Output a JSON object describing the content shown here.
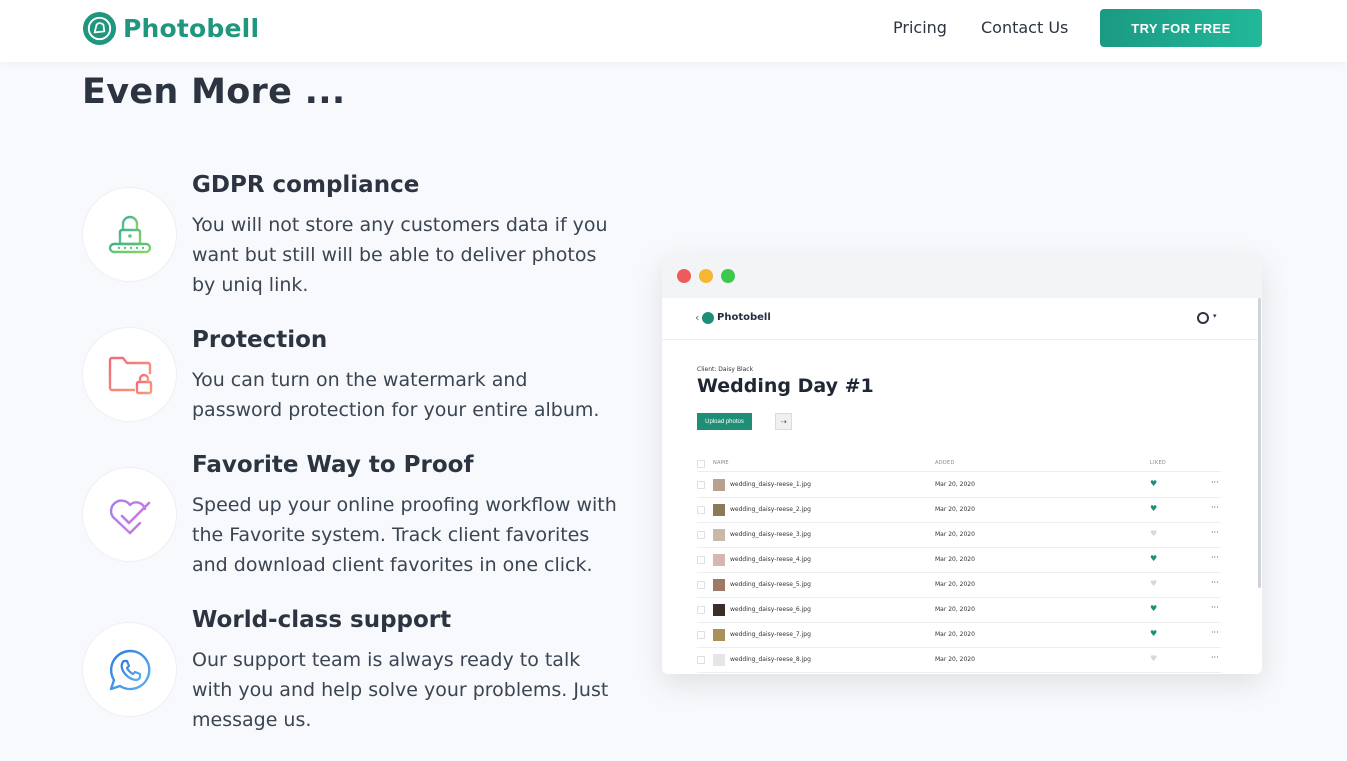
{
  "nav": {
    "brand": "Photobell",
    "pricing": "Pricing",
    "contact": "Contact Us",
    "cta": "TRY FOR FREE"
  },
  "section": {
    "title": "Even More ..."
  },
  "features": [
    {
      "title": "GDPR compliance",
      "text": "You will not store any customers data if you want but still will be able to deliver photos by uniq link.",
      "icon": "lock-icon"
    },
    {
      "title": "Protection",
      "text": "You can turn on the watermark and password protection for your entire album.",
      "icon": "folder-lock-icon"
    },
    {
      "title": "Favorite Way to Proof",
      "text": "Speed up your online proofing workflow with the Favorite system. Track client favorites and download client favorites in one click.",
      "icon": "heart-check-icon"
    },
    {
      "title": "World-class support",
      "text": "Our support team is always ready to talk with you and help solve your problems. Just message us.",
      "icon": "chat-phone-icon"
    }
  ],
  "mock": {
    "brand": "Photobell",
    "client": "Client: Daisy Black",
    "album_title": "Wedding Day #1",
    "upload": "Upload photos",
    "columns": {
      "name": "NAME",
      "added": "ADDED",
      "liked": "LIKED"
    },
    "rows": [
      {
        "name": "wedding_daisy-reese_1.jpg",
        "date": "Mar 20, 2020",
        "liked": true
      },
      {
        "name": "wedding_daisy-reese_2.jpg",
        "date": "Mar 20, 2020",
        "liked": true
      },
      {
        "name": "wedding_daisy-reese_3.jpg",
        "date": "Mar 20, 2020",
        "liked": false
      },
      {
        "name": "wedding_daisy-reese_4.jpg",
        "date": "Mar 20, 2020",
        "liked": true
      },
      {
        "name": "wedding_daisy-reese_5.jpg",
        "date": "Mar 20, 2020",
        "liked": false
      },
      {
        "name": "wedding_daisy-reese_6.jpg",
        "date": "Mar 20, 2020",
        "liked": true
      },
      {
        "name": "wedding_daisy-reese_7.jpg",
        "date": "Mar 20, 2020",
        "liked": true
      },
      {
        "name": "wedding_daisy-reese_8.jpg",
        "date": "Mar 20, 2020",
        "liked": false
      }
    ]
  },
  "colors": {
    "brand": "#21967e",
    "liked": "#1f8e77",
    "unliked": "#d5d8dc"
  }
}
